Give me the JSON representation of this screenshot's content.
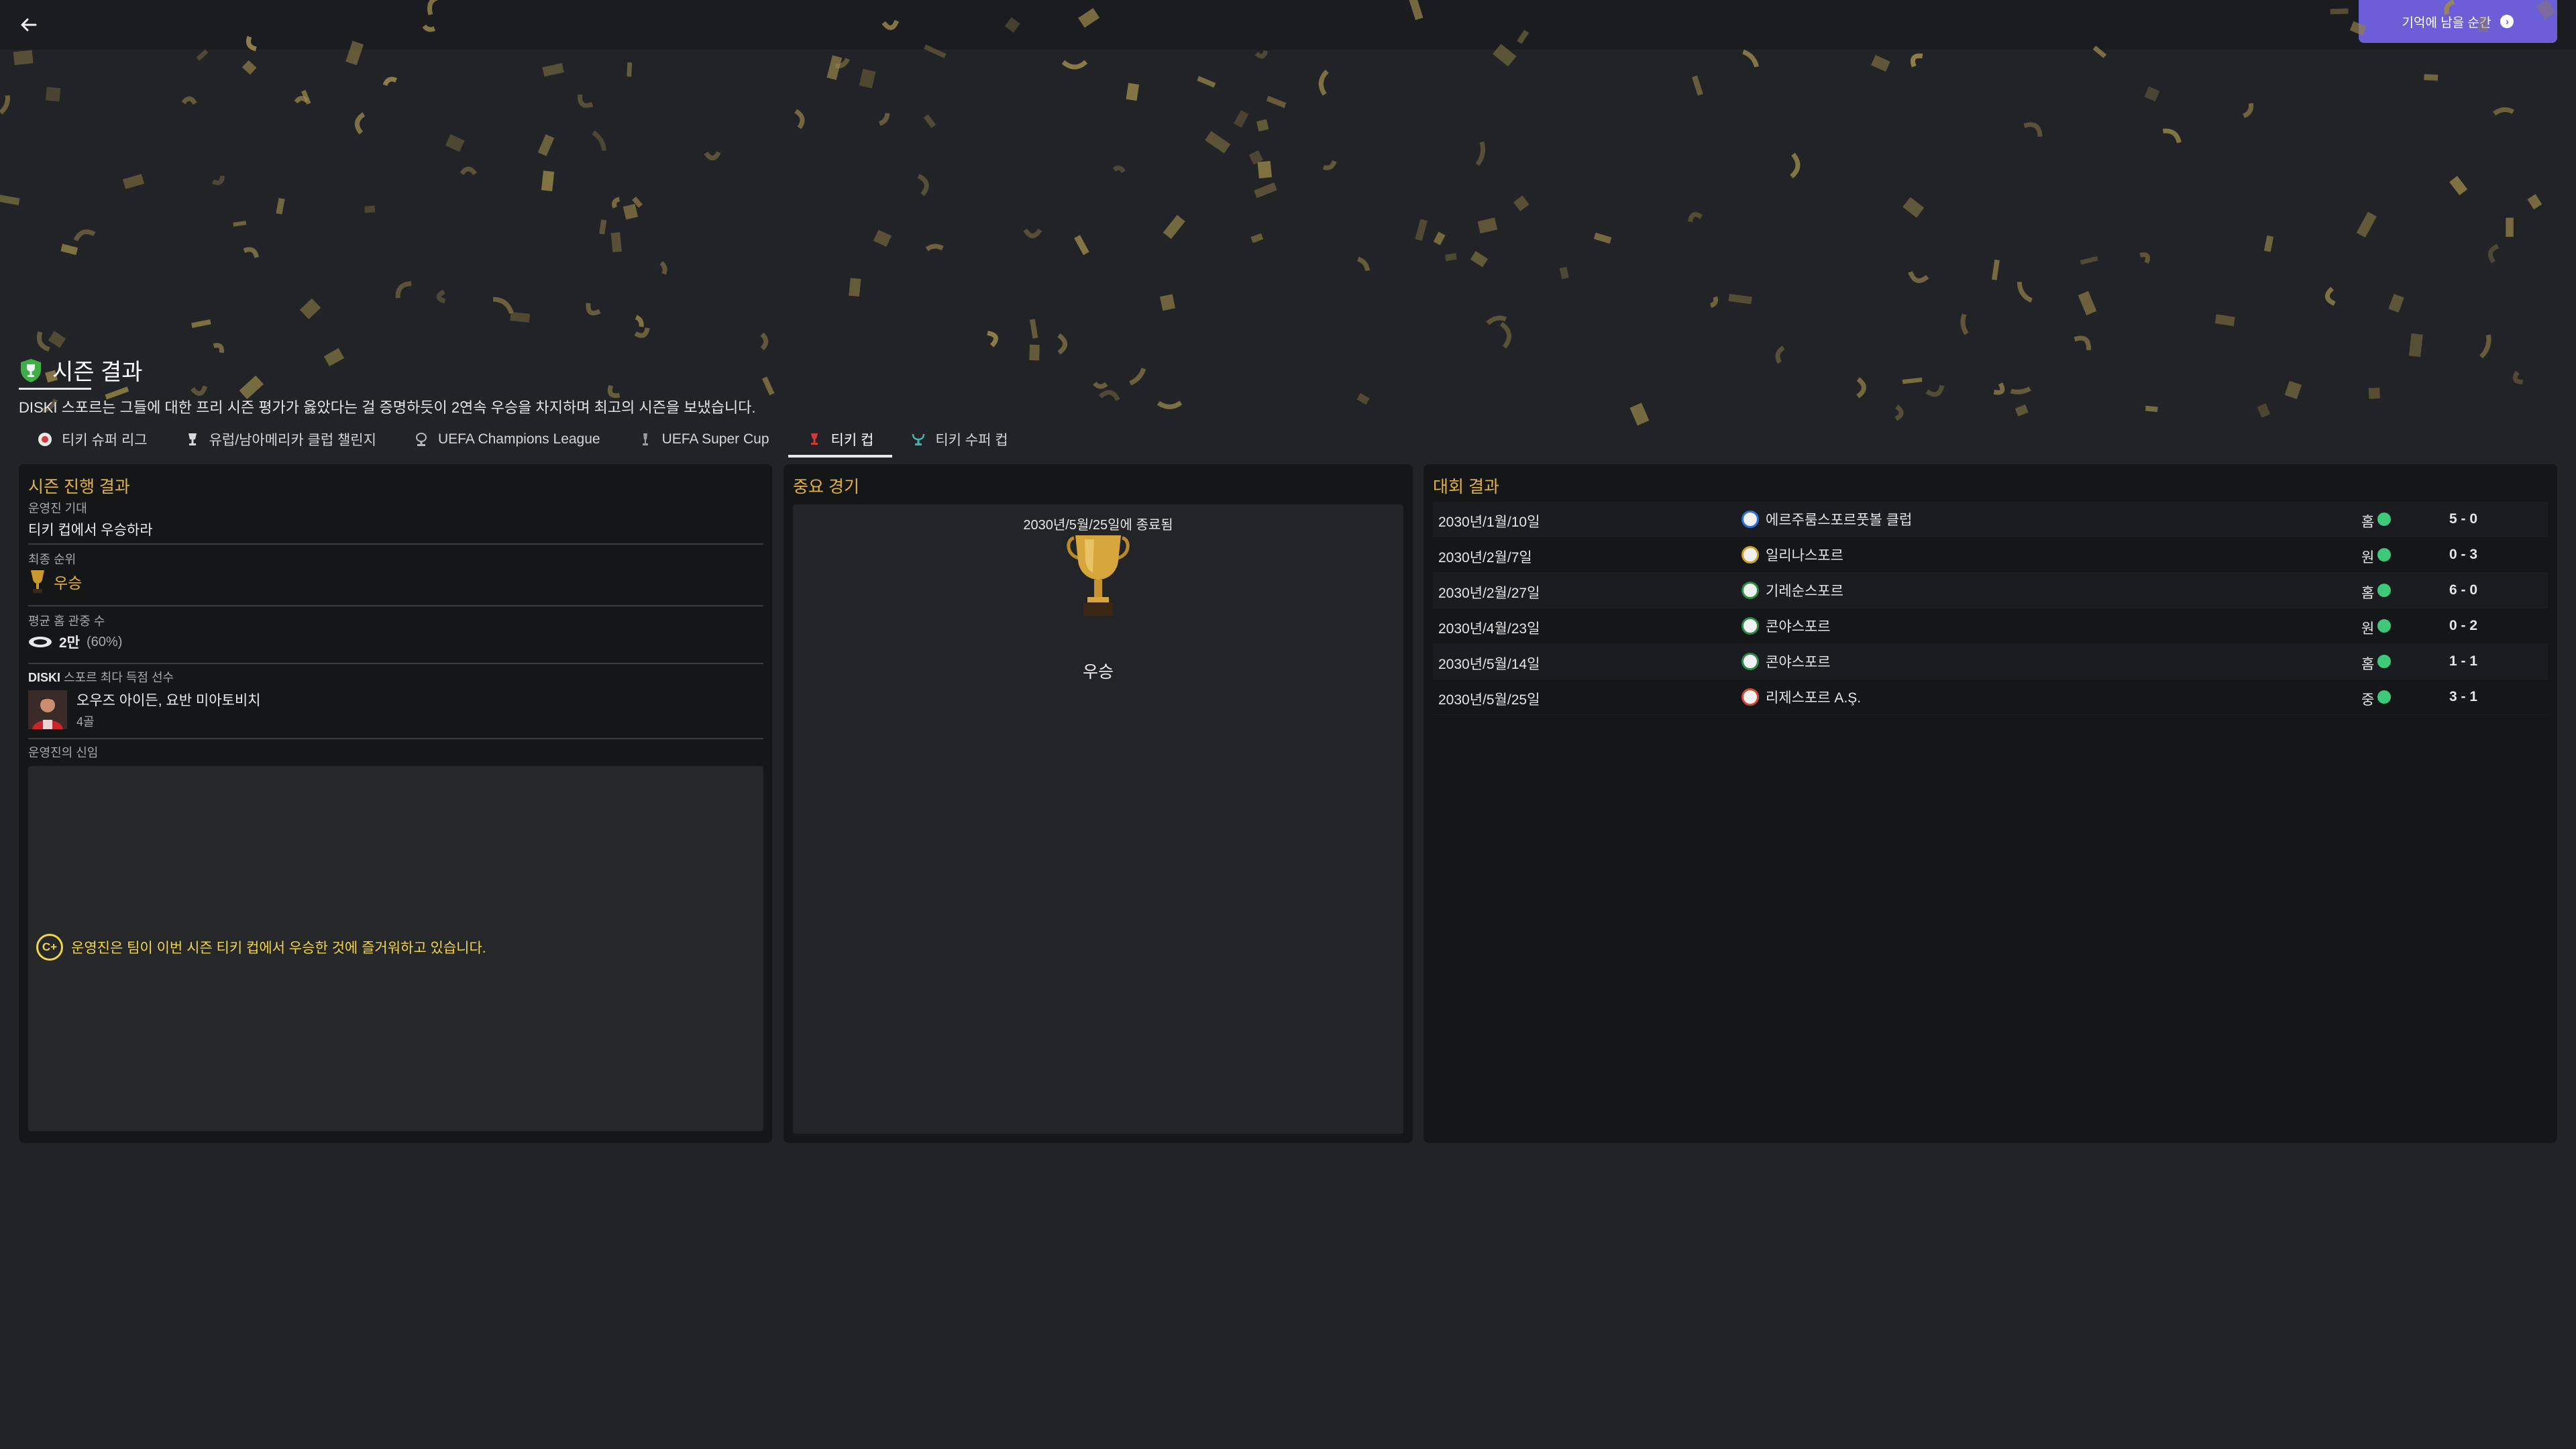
{
  "topbar": {
    "back_icon": "arrow-left-icon",
    "cta_label": "기억에 남을 순간",
    "cta_icon": "chevron-right-circle-icon"
  },
  "header": {
    "title": "시즌 결과",
    "subtitle": "DISKI 스포르는 그들에 대한 프리 시즌 평가가 옳았다는 걸 증명하듯이 2연속 우승을 차지하며 최고의 시즌을 보냈습니다."
  },
  "tabs": [
    {
      "label": "티키 슈퍼 리그",
      "icon": "league-ball-icon"
    },
    {
      "label": "유럽/남아메리카 클럽 챌린지",
      "icon": "trophy-icon"
    },
    {
      "label": "UEFA Champions League",
      "icon": "ucl-trophy-icon"
    },
    {
      "label": "UEFA Super Cup",
      "icon": "super-cup-icon"
    },
    {
      "label": "티키 컵",
      "icon": "cup-icon",
      "active": true
    },
    {
      "label": "티키 수퍼 컵",
      "icon": "super-cup-teal-icon"
    }
  ],
  "season_progress": {
    "title": "시즌 진행 결과",
    "board_expectation_label": "운영진 기대",
    "board_expectation_value": "티키 컵에서 우승하라",
    "final_position_label": "최종 순위",
    "final_position_value": "우승",
    "avg_attendance_label": "평균 홈 관중 수",
    "avg_attendance_value": "2만",
    "avg_attendance_pct": "(60%)",
    "top_scorer_label_strong": "DISKI",
    "top_scorer_label": "스포르 최다 득점 선수",
    "top_scorer_name": "오우즈 아이든, 요반 미아토비치",
    "top_scorer_goals": "4골",
    "board_confidence_label": "운영진의 신임",
    "board_grade": "C+",
    "board_message": "운영진은 팀이 이번 시즌 티키 컵에서 우승한 것에 즐거워하고 있습니다."
  },
  "key_game": {
    "title": "중요 경기",
    "date": "2030년/5월/25일에 종료됨",
    "result": "우승"
  },
  "competition_results": {
    "title": "대회 결과",
    "rows": [
      {
        "date": "2030년/1월/10일",
        "opponent": "에르주룸스포르풋볼 클럽",
        "crest_color": "#2f6fd1",
        "venue": "홈",
        "score": "5 - 0"
      },
      {
        "date": "2030년/2월/7일",
        "opponent": "일리나스포르",
        "crest_color": "#c9a227",
        "venue": "원",
        "score": "0 - 3"
      },
      {
        "date": "2030년/2월/27일",
        "opponent": "기레순스포르",
        "crest_color": "#2e8a3e",
        "venue": "홈",
        "score": "6 - 0"
      },
      {
        "date": "2030년/4월/23일",
        "opponent": "콘야스포르",
        "crest_color": "#2f8a4c",
        "venue": "원",
        "score": "0 - 2"
      },
      {
        "date": "2030년/5월/14일",
        "opponent": "콘야스포르",
        "crest_color": "#2f8a4c",
        "venue": "홈",
        "score": "1 - 1"
      },
      {
        "date": "2030년/5월/25일",
        "opponent": "리제스포르 A.Ş.",
        "crest_color": "#d04a3a",
        "venue": "중",
        "score": "3 - 1"
      }
    ]
  }
}
